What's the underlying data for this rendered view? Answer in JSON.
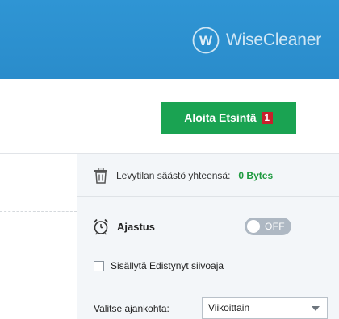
{
  "header": {
    "brand_name": "WiseCleaner",
    "logo_letter": "W",
    "brand_color": "#2f95d4"
  },
  "toolbar": {
    "scan_button_label": "Aloita Etsintä",
    "scan_badge": "1",
    "scan_button_color": "#1aa352"
  },
  "panel": {
    "savings_label": "Levytilan säästö yhteensä:",
    "savings_value": "0 Bytes",
    "savings_icon": "trash-icon",
    "schedule_label": "Ajastus",
    "schedule_icon": "alarm-clock-icon",
    "schedule_toggle_text": "OFF",
    "schedule_enabled": false,
    "advanced_label": "Sisällytä Edistynyt siivoaja",
    "advanced_checked": false,
    "time_label": "Valitse ajankohta:",
    "time_value": "Viikoittain"
  }
}
